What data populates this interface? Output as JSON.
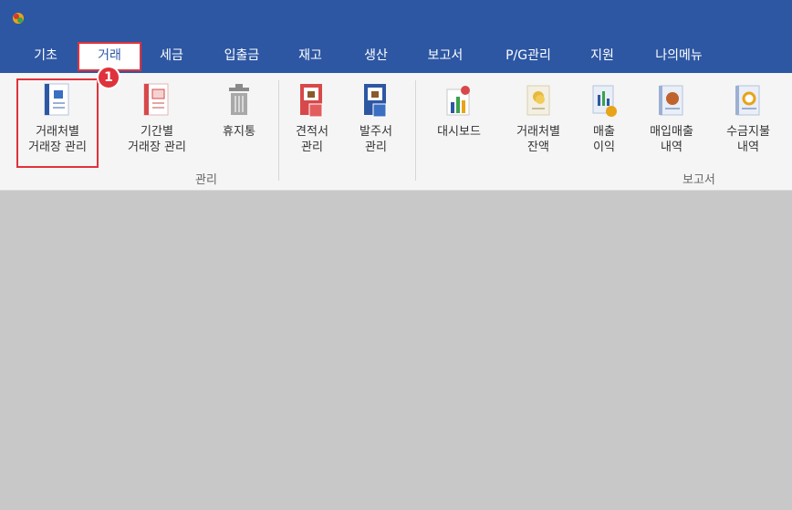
{
  "menu": {
    "tabs": [
      {
        "label": "기초"
      },
      {
        "label": "거래"
      },
      {
        "label": "세금"
      },
      {
        "label": "입출금"
      },
      {
        "label": "재고"
      },
      {
        "label": "생산"
      },
      {
        "label": "보고서"
      },
      {
        "label": "P/G관리"
      },
      {
        "label": "지원"
      },
      {
        "label": "나의메뉴"
      }
    ],
    "active_tab": "거래"
  },
  "ribbon": {
    "buttons": [
      {
        "label": "거래처별\n거래장 관리",
        "icon": "ledger-book-icon"
      },
      {
        "label": "기간별\n거래장 관리",
        "icon": "calendar-ledger-icon"
      },
      {
        "label": "휴지통",
        "icon": "trash-icon"
      },
      {
        "label": "견적서\n관리",
        "icon": "quote-document-icon"
      },
      {
        "label": "발주서\n관리",
        "icon": "purchase-order-icon"
      },
      {
        "label": "대시보드",
        "icon": "dashboard-chart-icon"
      },
      {
        "label": "거래처별\n잔액",
        "icon": "balance-coins-icon"
      },
      {
        "label": "매출\n이익",
        "icon": "sales-profit-icon"
      },
      {
        "label": "매입매출\n내역",
        "icon": "purchase-sales-history-icon"
      },
      {
        "label": "수금지불\n내역",
        "icon": "payment-history-icon"
      }
    ],
    "groups": {
      "manage": "관리",
      "report": "보고서"
    }
  },
  "annotation": {
    "step": "1"
  },
  "colors": {
    "titlebar": "#2d57a3",
    "highlight": "#e0323b",
    "workspace": "#c8c8c8"
  }
}
